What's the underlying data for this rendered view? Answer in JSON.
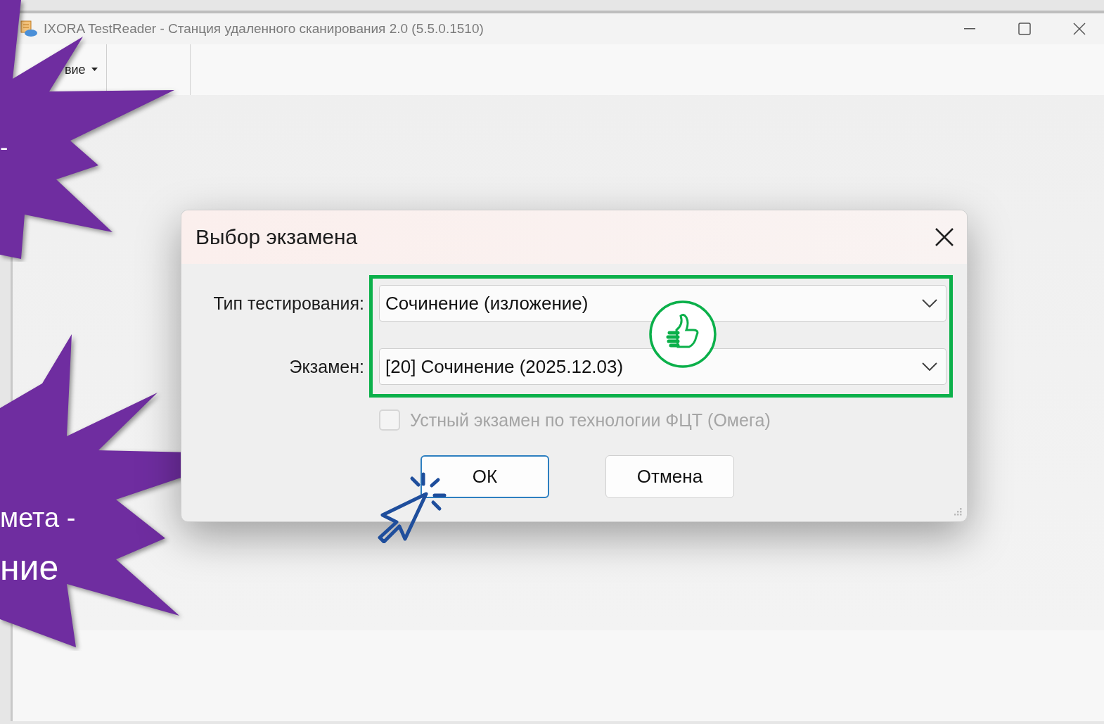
{
  "window": {
    "title": "IXORA TestReader - Станция удаленного сканирования 2.0 (5.5.0.1510)"
  },
  "toolbar": {
    "items": [
      {
        "label": "вие"
      }
    ]
  },
  "dialog": {
    "title": "Выбор экзамена",
    "fields": [
      {
        "label": "Тип тестирования:",
        "value": "Сочинение (изложение)"
      },
      {
        "label": "Экзамен:",
        "value": "[20] Сочинение (2025.12.03)"
      }
    ],
    "checkbox": {
      "label": "Устный экзамен по технологии ФЦТ (Омега)",
      "checked": false,
      "disabled": true
    },
    "buttons": [
      {
        "label": "ОК",
        "default": true
      },
      {
        "label": "Отмена",
        "default": false
      }
    ]
  },
  "callouts": [
    {
      "lines": [
        "-"
      ]
    },
    {
      "lines": [
        "мета -",
        "ние"
      ]
    }
  ]
}
